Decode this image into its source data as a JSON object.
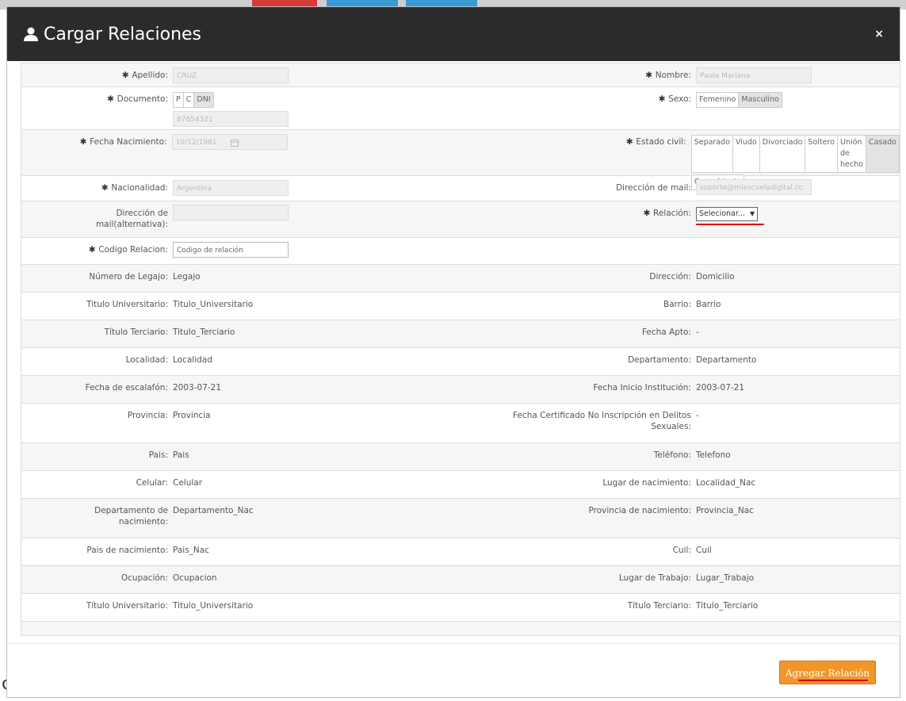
{
  "background": {
    "corner_text": "c"
  },
  "modal": {
    "title": "Cargar Relaciones",
    "close": "×",
    "form": {
      "apellido": {
        "label": "Apellido:",
        "value": "CRUZ"
      },
      "nombre": {
        "label": "Nombre:",
        "value": "Paula Mariana"
      },
      "documento": {
        "label": "Documento:",
        "options": [
          "P",
          "C",
          "DNI"
        ],
        "value": "87654321"
      },
      "sexo": {
        "label": "Sexo:",
        "options": [
          "Femenino",
          "Masculino"
        ]
      },
      "fecha_nacimiento": {
        "label": "Fecha Nacimiento:",
        "value": "10/12/1981"
      },
      "estado_civil": {
        "label": "Estado civil:",
        "options": [
          "Separado",
          "Viudo",
          "Divorciado",
          "Soltero",
          "Unión de hecho",
          "Casado",
          "Concubinato"
        ]
      },
      "nacionalidad": {
        "label": "Nacionalidad:",
        "value": "Argentina"
      },
      "mail": {
        "label": "Dirección de mail:",
        "value": "soporte@miescueladigital.cc"
      },
      "mail_alt": {
        "label": "Dirección de mail(alternativa):",
        "value": ""
      },
      "relacion": {
        "label": "Relación:",
        "value": "Selecionar..."
      },
      "codigo_relacion": {
        "label": "Codigo Relacion:",
        "placeholder": "Codigo de relación"
      }
    },
    "details": [
      {
        "l_label": "Número de Legajo:",
        "l_value": "Legajo",
        "r_label": "Dirección:",
        "r_value": "Domicilio"
      },
      {
        "l_label": "Titulo Universitario:",
        "l_value": "Titulo_Universitario",
        "r_label": "Barrio:",
        "r_value": "Barrio"
      },
      {
        "l_label": "Título Terciario:",
        "l_value": "Titulo_Terciario",
        "r_label": "Fecha Apto:",
        "r_value": "-"
      },
      {
        "l_label": "Localidad:",
        "l_value": "Localidad",
        "r_label": "Departamento:",
        "r_value": "Departamento"
      },
      {
        "l_label": "Fecha de escalafón:",
        "l_value": "2003-07-21",
        "r_label": "Fecha Inicio Institución:",
        "r_value": "2003-07-21"
      },
      {
        "l_label": "Provincia:",
        "l_value": "Provincia",
        "r_label": "Fecha Certificado No Inscripción en Delitos Sexuales:",
        "r_value": "-"
      },
      {
        "l_label": "Pais:",
        "l_value": "Pais",
        "r_label": "Teléfono:",
        "r_value": "Telefono"
      },
      {
        "l_label": "Celular:",
        "l_value": "Celular",
        "r_label": "Lugar de nacimiento:",
        "r_value": "Localidad_Nac"
      },
      {
        "l_label": "Departamento de nacimiento:",
        "l_value": "Departamento_Nac",
        "r_label": "Provincia de nacimiento:",
        "r_value": "Provincia_Nac"
      },
      {
        "l_label": "Pais de nacimiento:",
        "l_value": "Pais_Nac",
        "r_label": "Cuil:",
        "r_value": "Cuil"
      },
      {
        "l_label": "Ocupación:",
        "l_value": "Ocupacion",
        "r_label": "Lugar de Trabajo:",
        "r_value": "Lugar_Trabajo"
      },
      {
        "l_label": "Título Universitario:",
        "l_value": "Titulo_Universitario",
        "r_label": "Título Terciario:",
        "r_value": "Titulo_Terciario"
      }
    ],
    "submit_label": "Agregar Relación"
  },
  "colors": {
    "header": "#2b2b2b",
    "button": "#f0962a",
    "annotation": "#d00000"
  }
}
